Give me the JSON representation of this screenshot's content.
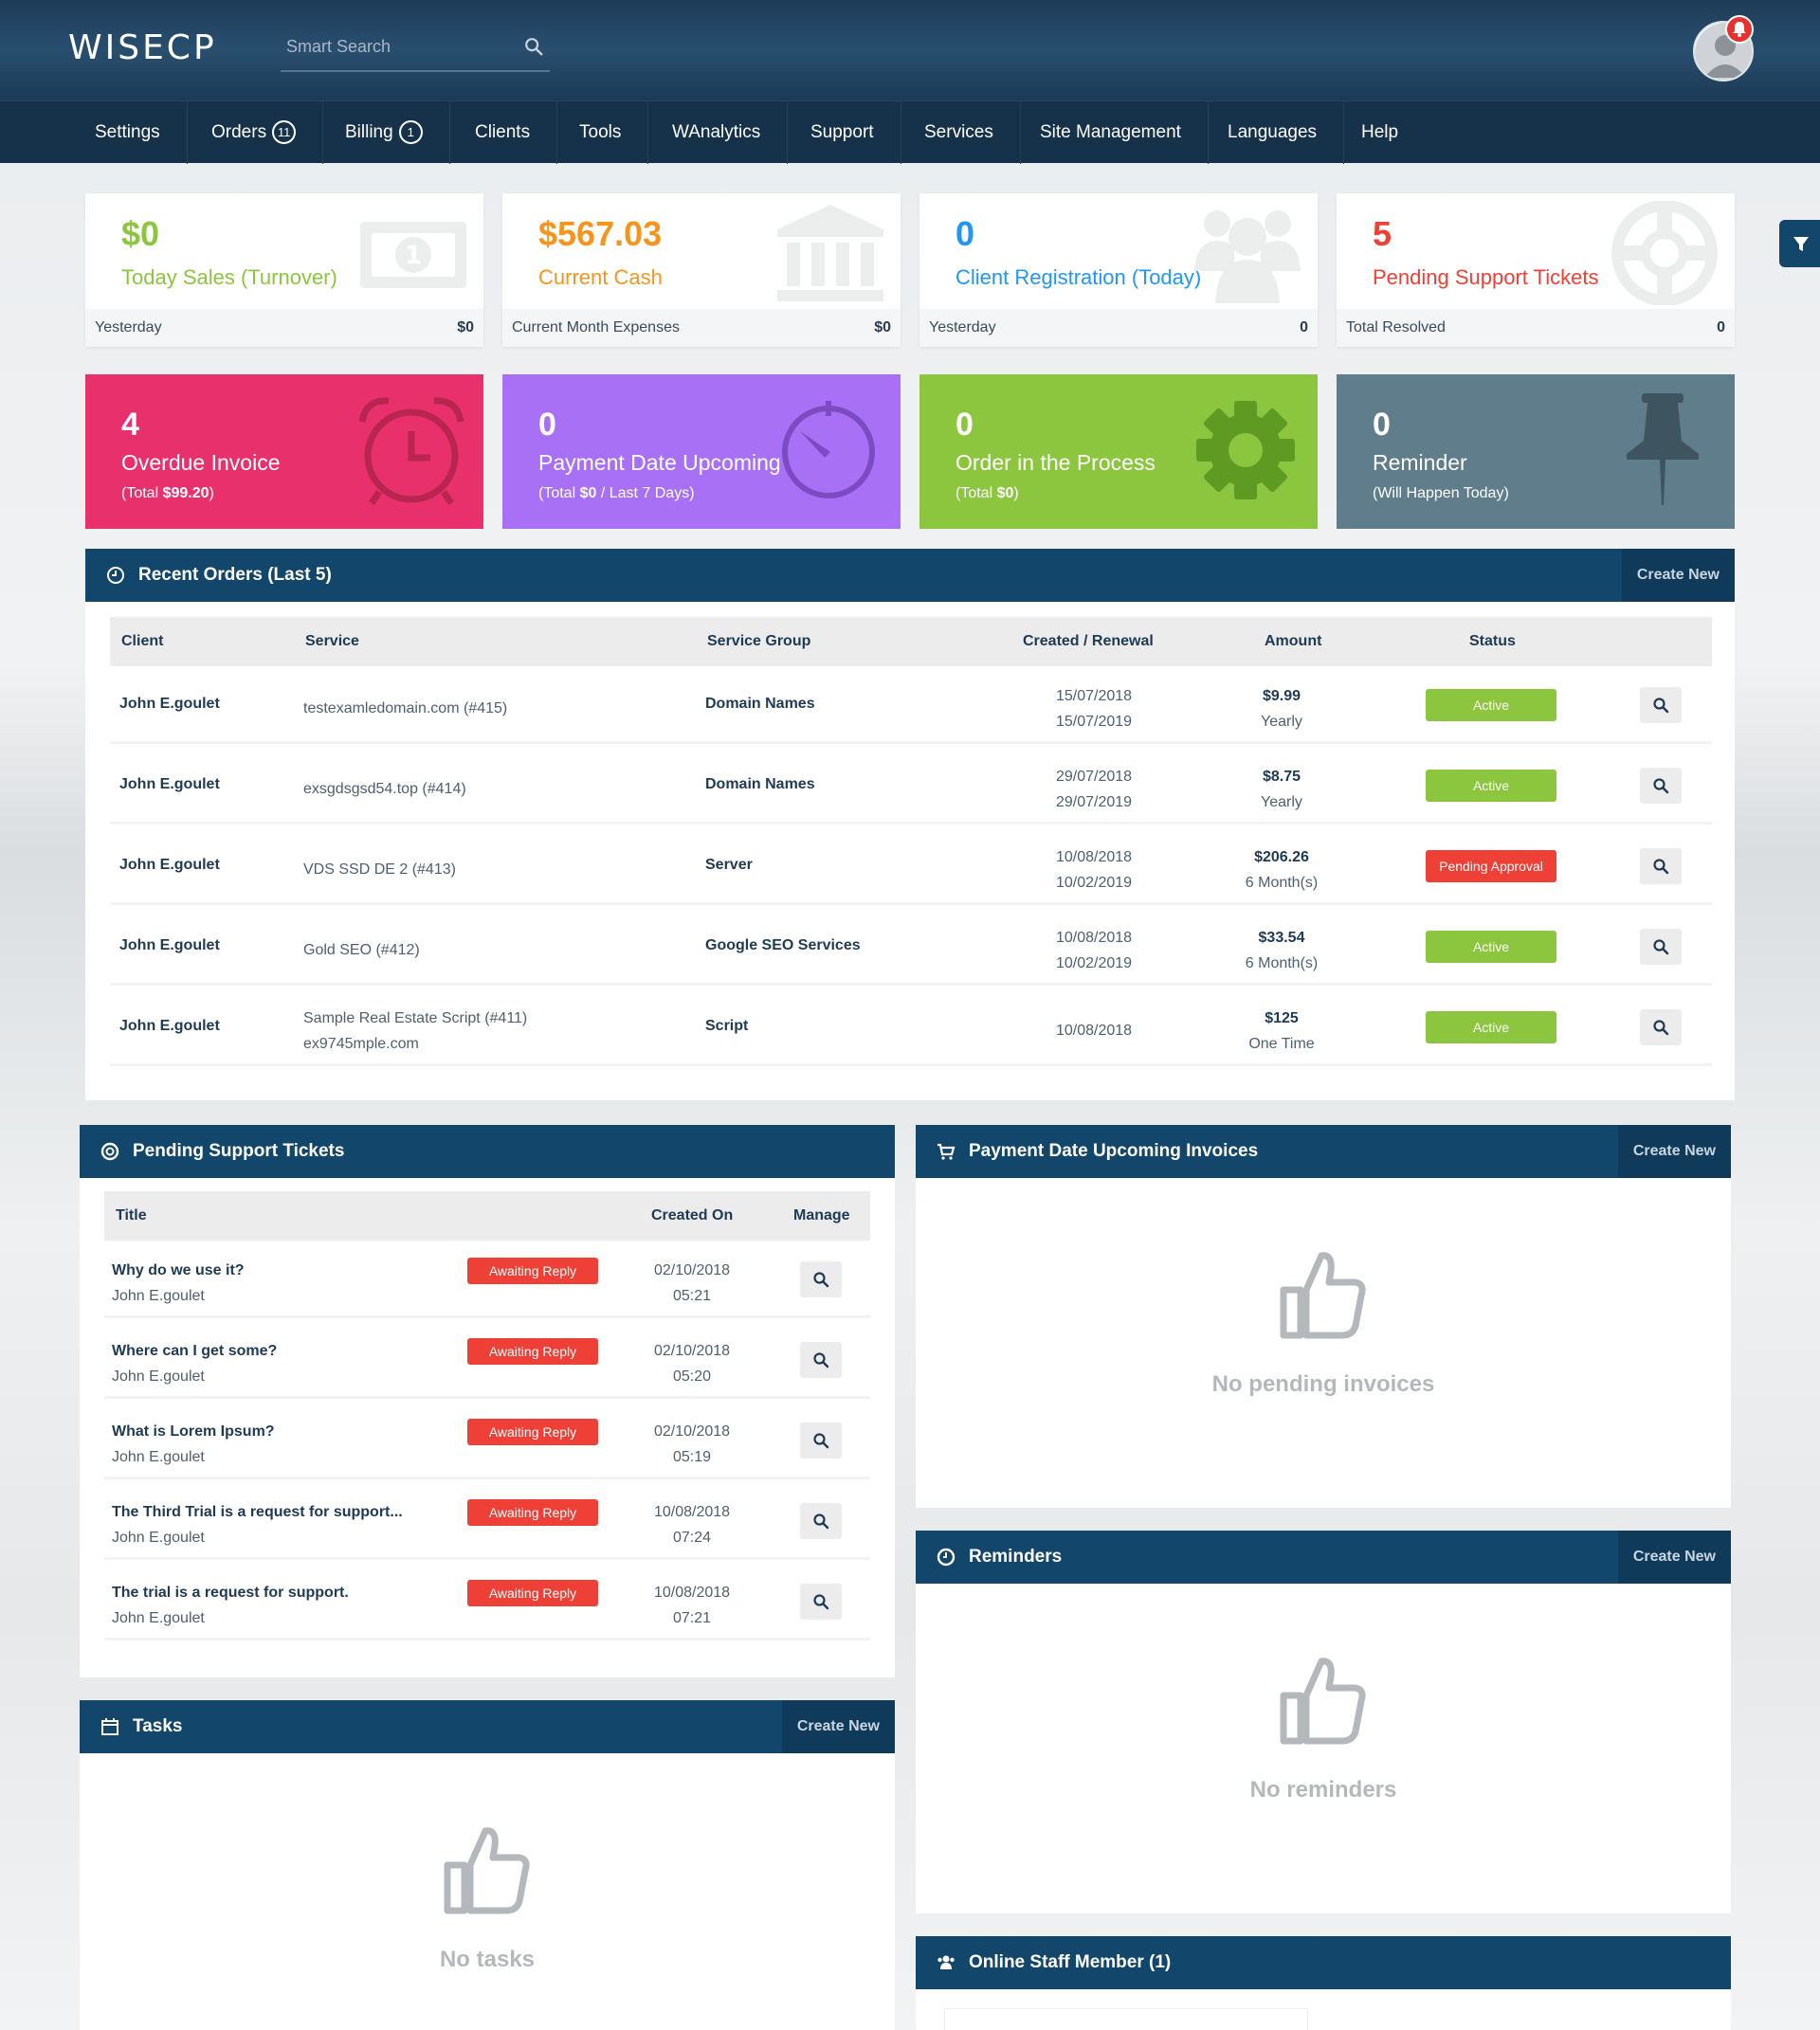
{
  "header": {
    "logo": "WISECP",
    "search_placeholder": "Smart Search"
  },
  "nav": [
    {
      "label": "Settings"
    },
    {
      "label": "Orders",
      "badge": "11"
    },
    {
      "label": "Billing",
      "badge": "1"
    },
    {
      "label": "Clients"
    },
    {
      "label": "Tools"
    },
    {
      "label": "WAnalytics"
    },
    {
      "label": "Support"
    },
    {
      "label": "Services"
    },
    {
      "label": "Site Management"
    },
    {
      "label": "Languages"
    },
    {
      "label": "Help"
    }
  ],
  "stats": [
    {
      "value": "$0",
      "label": "Today Sales (Turnover)",
      "foot_label": "Yesterday",
      "foot_value": "$0",
      "color": "#8cc63f",
      "icon": "money-icon"
    },
    {
      "value": "$567.03",
      "label": "Current Cash",
      "foot_label": "Current Month Expenses",
      "foot_value": "$0",
      "color": "#f7941d",
      "icon": "bank-icon"
    },
    {
      "value": "0",
      "label": "Client Registration (Today)",
      "foot_label": "Yesterday",
      "foot_value": "0",
      "color": "#2196f3",
      "icon": "users-icon"
    },
    {
      "value": "5",
      "label": "Pending Support Tickets",
      "foot_label": "Total Resolved",
      "foot_value": "0",
      "color": "#ee4036",
      "icon": "lifebuoy-icon"
    }
  ],
  "color_cards": [
    {
      "value": "4",
      "title": "Overdue Invoice",
      "sub_pre": "(Total ",
      "sub_bold": "$99.20",
      "sub_post": ")",
      "color": "#e8306d",
      "icon": "alarm-clock-icon"
    },
    {
      "value": "0",
      "title": "Payment Date Upcoming",
      "sub_pre": "(Total ",
      "sub_bold": "$0",
      "sub_post": " / Last 7 Days)",
      "color": "#a871f5",
      "icon": "gauge-icon"
    },
    {
      "value": "0",
      "title": "Order in the Process",
      "sub_pre": "(Total ",
      "sub_bold": "$0",
      "sub_post": ")",
      "color": "#8cc63f",
      "icon": "gear-icon"
    },
    {
      "value": "0",
      "title": "Reminder",
      "sub_pre": "(Will Happen Today)",
      "sub_bold": "",
      "sub_post": "",
      "color": "#607d8b",
      "icon": "pushpin-icon"
    }
  ],
  "recent_orders": {
    "title": "Recent Orders (Last 5)",
    "create_label": "Create New",
    "columns": [
      "Client",
      "Service",
      "Service Group",
      "Created / Renewal",
      "Amount",
      "Status"
    ],
    "rows": [
      {
        "client": "John E.goulet",
        "service": "testexamledomain.com (#415)",
        "service2": "",
        "group": "Domain Names",
        "created": "15/07/2018",
        "renewal": "15/07/2019",
        "amount": "$9.99",
        "period": "Yearly",
        "status": "Active",
        "status_type": "active"
      },
      {
        "client": "John E.goulet",
        "service": "exsgdsgsd54.top (#414)",
        "service2": "",
        "group": "Domain Names",
        "created": "29/07/2018",
        "renewal": "29/07/2019",
        "amount": "$8.75",
        "period": "Yearly",
        "status": "Active",
        "status_type": "active"
      },
      {
        "client": "John E.goulet",
        "service": "VDS SSD DE 2 (#413)",
        "service2": "",
        "group": "Server",
        "created": "10/08/2018",
        "renewal": "10/02/2019",
        "amount": "$206.26",
        "period": "6 Month(s)",
        "status": "Pending Approval",
        "status_type": "pending"
      },
      {
        "client": "John E.goulet",
        "service": "Gold SEO (#412)",
        "service2": "",
        "group": "Google SEO Services",
        "created": "10/08/2018",
        "renewal": "10/02/2019",
        "amount": "$33.54",
        "period": "6 Month(s)",
        "status": "Active",
        "status_type": "active"
      },
      {
        "client": "John E.goulet",
        "service": "Sample Real Estate Script (#411)",
        "service2": "ex9745mple.com",
        "group": "Script",
        "created": "10/08/2018",
        "renewal": "",
        "amount": "$125",
        "period": "One Time",
        "status": "Active",
        "status_type": "active"
      }
    ]
  },
  "tickets": {
    "title": "Pending Support Tickets",
    "columns": [
      "Title",
      "Created On",
      "Manage"
    ],
    "rows": [
      {
        "title": "Why do we use it?",
        "client": "John E.goulet",
        "status": "Awaiting Reply",
        "date": "02/10/2018",
        "time": "05:21"
      },
      {
        "title": "Where can I get some?",
        "client": "John E.goulet",
        "status": "Awaiting Reply",
        "date": "02/10/2018",
        "time": "05:20"
      },
      {
        "title": "What is Lorem Ipsum?",
        "client": "John E.goulet",
        "status": "Awaiting Reply",
        "date": "02/10/2018",
        "time": "05:19"
      },
      {
        "title": "The Third Trial is a request for support...",
        "client": "John E.goulet",
        "status": "Awaiting Reply",
        "date": "10/08/2018",
        "time": "07:24"
      },
      {
        "title": "The trial is a request for support.",
        "client": "John E.goulet",
        "status": "Awaiting Reply",
        "date": "10/08/2018",
        "time": "07:21"
      }
    ]
  },
  "invoices": {
    "title": "Payment Date Upcoming Invoices",
    "create_label": "Create New",
    "empty": "No pending invoices"
  },
  "reminders": {
    "title": "Reminders",
    "create_label": "Create New",
    "empty": "No reminders"
  },
  "tasks": {
    "title": "Tasks",
    "create_label": "Create New",
    "empty": "No tasks"
  },
  "staff": {
    "title": "Online Staff Member (1)"
  }
}
